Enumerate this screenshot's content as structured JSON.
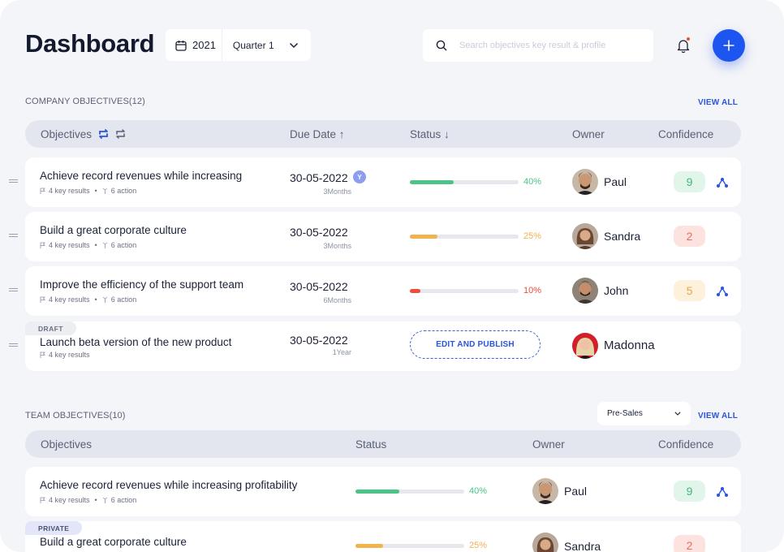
{
  "header": {
    "title": "Dashboard",
    "year": "2021",
    "quarter": "Quarter 1",
    "search_placeholder": "Search objectives key result & profile"
  },
  "company": {
    "title": "COMPANY OBJECTIVES(12)",
    "view_all": "VIEW ALL",
    "columns": {
      "objectives": "Objectives",
      "due": "Due Date ↑",
      "status": "Status ↓",
      "owner": "Owner",
      "confidence": "Confidence"
    },
    "rows": [
      {
        "title": "Achieve record revenues while increasing",
        "key_results": "4 key results",
        "actions": "6 action",
        "due": "30-05-2022",
        "duration": "3Months",
        "badge": "Y",
        "progress": 0.4,
        "pct": "40%",
        "color": "#4cc387",
        "owner": "Paul",
        "confidence": "9",
        "conf_bg": "#e2f5ea",
        "conf_fg": "#3eb878"
      },
      {
        "title": "Build a great corporate culture",
        "key_results": "4 key results",
        "actions": "6 action",
        "due": "30-05-2022",
        "duration": "3Months",
        "progress": 0.25,
        "pct": "25%",
        "color": "#f1b250",
        "owner": "Sandra",
        "confidence": "2",
        "conf_bg": "#fde3df",
        "conf_fg": "#ef6c5a"
      },
      {
        "title": "Improve the efficiency of the support team",
        "key_results": "4 key results",
        "actions": "6 action",
        "due": "30-05-2022",
        "duration": "6Months",
        "progress": 0.1,
        "pct": "10%",
        "color": "#ee4f38",
        "owner": "John",
        "confidence": "5",
        "conf_bg": "#fdf1dc",
        "conf_fg": "#e4a54a"
      },
      {
        "tag": "DRAFT",
        "title": "Launch beta version of the new product",
        "key_results": "4 key results",
        "due": "30-05-2022",
        "duration": "1Year",
        "publish": "EDIT AND PUBLISH",
        "owner": "Madonna"
      }
    ]
  },
  "team": {
    "title": "TEAM OBJECTIVES(10)",
    "view_all": "VIEW ALL",
    "filter": "Pre-Sales",
    "columns": {
      "objectives": "Objectives",
      "status": "Status",
      "owner": "Owner",
      "confidence": "Confidence"
    },
    "rows": [
      {
        "title": "Achieve record revenues while increasing profitability",
        "key_results": "4 key results",
        "actions": "6 action",
        "progress": 0.4,
        "pct": "40%",
        "color": "#4cc387",
        "owner": "Paul",
        "confidence": "9",
        "conf_bg": "#e2f5ea",
        "conf_fg": "#3eb878"
      },
      {
        "tag": "PRIVATE",
        "title": "Build a great corporate culture",
        "progress": 0.25,
        "pct": "25%",
        "color": "#f1b250",
        "owner": "Sandra",
        "confidence": "2",
        "conf_bg": "#fde3df",
        "conf_fg": "#ef6c5a"
      }
    ]
  },
  "colors": {
    "accent": "#1c55ef",
    "link": "#2a55e0"
  }
}
